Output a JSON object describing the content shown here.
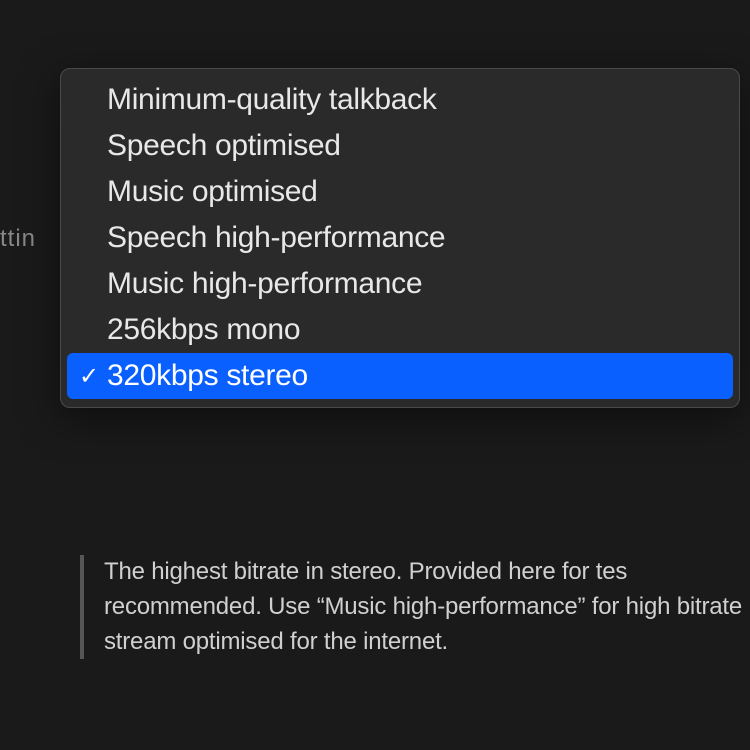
{
  "background": {
    "partial_text": "ttin"
  },
  "dropdown": {
    "items": [
      {
        "label": "Minimum-quality talkback",
        "selected": false
      },
      {
        "label": "Speech optimised",
        "selected": false
      },
      {
        "label": "Music optimised",
        "selected": false
      },
      {
        "label": "Speech high-performance",
        "selected": false
      },
      {
        "label": "Music high-performance",
        "selected": false
      },
      {
        "label": "256kbps mono",
        "selected": false
      },
      {
        "label": "320kbps stereo",
        "selected": true
      }
    ],
    "checkmark": "✓"
  },
  "description": {
    "text": "The highest bitrate in stereo. Provided here for tes recommended. Use “Music high-performance” for high bitrate stream optimised for the internet."
  }
}
